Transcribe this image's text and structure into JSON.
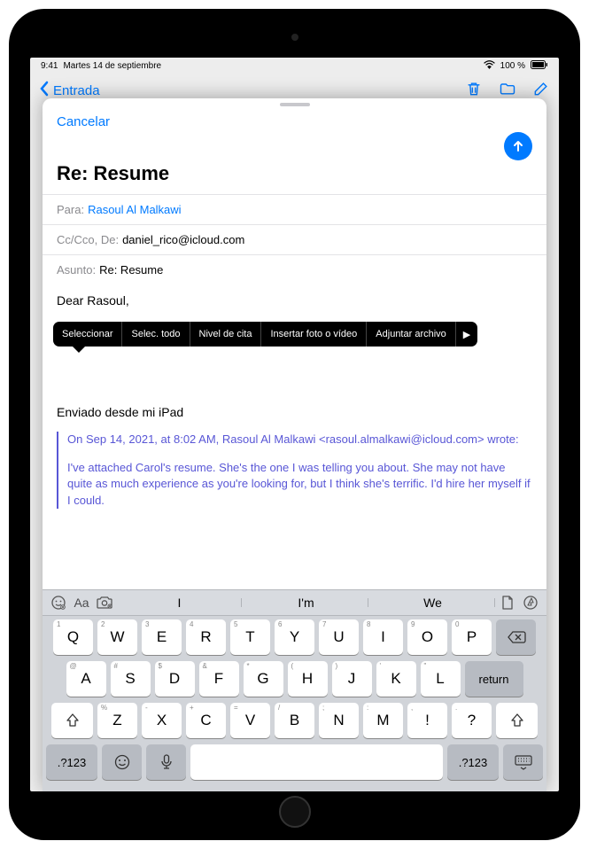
{
  "status_bar": {
    "time": "9:41",
    "date": "Martes 14 de septiembre",
    "battery_text": "100 %",
    "wifi": true
  },
  "back_nav": {
    "back_label": "Entrada"
  },
  "compose": {
    "cancel": "Cancelar",
    "title": "Re: Resume",
    "to_label": "Para:",
    "to_value": "Rasoul Al Malkawi",
    "cc_label": "Cc/Cco, De:",
    "cc_value": "daniel_rico@icloud.com",
    "subject_label": "Asunto:",
    "subject_value": "Re: Resume",
    "body_greeting": "Dear Rasoul,",
    "signature": "Enviado desde mi iPad",
    "quote_header": "On Sep 14, 2021, at 8:02 AM, Rasoul Al Malkawi <rasoul.almalkawi@icloud.com> wrote:",
    "quote_body": "I've attached Carol's resume. She's the one I was telling you about. She may not have quite as much experience as you're looking for, but I think she's terrific. I'd hire her myself if I could."
  },
  "context_menu": {
    "items": [
      "Seleccionar",
      "Selec. todo",
      "Nivel de cita",
      "Insertar foto o vídeo",
      "Adjuntar archivo"
    ]
  },
  "keyboard": {
    "suggestions": [
      "I",
      "I'm",
      "We"
    ],
    "row1": [
      {
        "main": "Q",
        "sub": "1"
      },
      {
        "main": "W",
        "sub": "2"
      },
      {
        "main": "E",
        "sub": "3"
      },
      {
        "main": "R",
        "sub": "4"
      },
      {
        "main": "T",
        "sub": "5"
      },
      {
        "main": "Y",
        "sub": "6"
      },
      {
        "main": "U",
        "sub": "7"
      },
      {
        "main": "I",
        "sub": "8"
      },
      {
        "main": "O",
        "sub": "9"
      },
      {
        "main": "P",
        "sub": "0"
      }
    ],
    "row2": [
      {
        "main": "A",
        "sub": "@"
      },
      {
        "main": "S",
        "sub": "#"
      },
      {
        "main": "D",
        "sub": "$"
      },
      {
        "main": "F",
        "sub": "&"
      },
      {
        "main": "G",
        "sub": "*"
      },
      {
        "main": "H",
        "sub": "("
      },
      {
        "main": "J",
        "sub": ")"
      },
      {
        "main": "K",
        "sub": "'"
      },
      {
        "main": "L",
        "sub": "\""
      }
    ],
    "row3": [
      {
        "main": "Z",
        "sub": "%"
      },
      {
        "main": "X",
        "sub": "-"
      },
      {
        "main": "C",
        "sub": "+"
      },
      {
        "main": "V",
        "sub": "="
      },
      {
        "main": "B",
        "sub": "/"
      },
      {
        "main": "N",
        "sub": ";"
      },
      {
        "main": "M",
        "sub": ":"
      },
      {
        "main": "!",
        "sub": ","
      },
      {
        "main": "?",
        "sub": "."
      }
    ],
    "return_label": "return",
    "numsym_label": ".?123"
  }
}
